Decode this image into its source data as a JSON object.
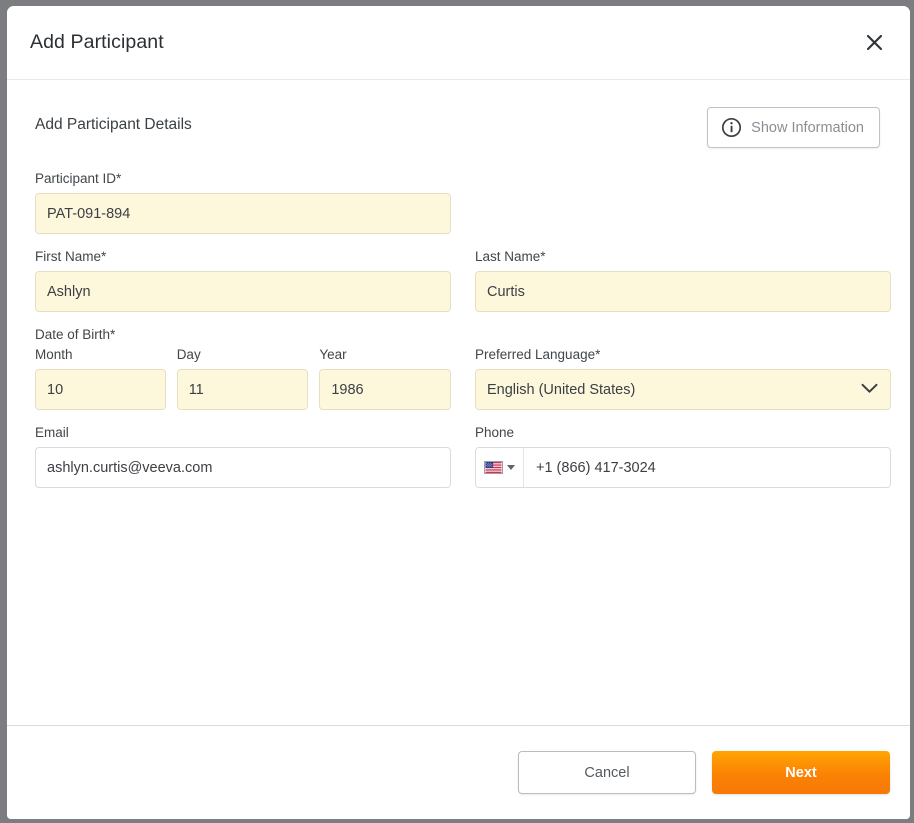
{
  "dialog": {
    "title": "Add Participant",
    "close_icon": "close-icon"
  },
  "section": {
    "heading": "Add Participant Details",
    "show_information": {
      "label": "Show Information",
      "icon": "info-circle-icon"
    }
  },
  "fields": {
    "participant_id": {
      "label": "Participant ID*",
      "value": "PAT-091-894",
      "placeholder": ""
    },
    "first_name": {
      "label": "First Name*",
      "value": "Ashlyn",
      "placeholder": ""
    },
    "last_name": {
      "label": "Last Name*",
      "value": "Curtis",
      "placeholder": ""
    },
    "date_of_birth": {
      "label": "Date of Birth*",
      "month": {
        "label": "Month",
        "value": "10",
        "placeholder": ""
      },
      "day": {
        "label": "Day",
        "value": "11",
        "placeholder": ""
      },
      "year": {
        "label": "Year",
        "value": "1986",
        "placeholder": ""
      }
    },
    "preferred_language": {
      "label": "Preferred Language*",
      "value": "English (United States)",
      "icon": "chevron-down-icon"
    },
    "email": {
      "label": "Email",
      "value": "ashlyn.curtis@veeva.com",
      "placeholder": ""
    },
    "phone": {
      "label": "Phone",
      "value": "+1 (866) 417-3024",
      "placeholder": "",
      "country_flag": "us-flag-icon",
      "country_caret": "caret-down-icon"
    }
  },
  "footer": {
    "cancel_label": "Cancel",
    "next_label": "Next"
  },
  "colors": {
    "required_field_bg": "#FDF7DC",
    "primary_button": "#FB8205",
    "text_dark": "#2C3033",
    "label_gray": "#41464A"
  }
}
